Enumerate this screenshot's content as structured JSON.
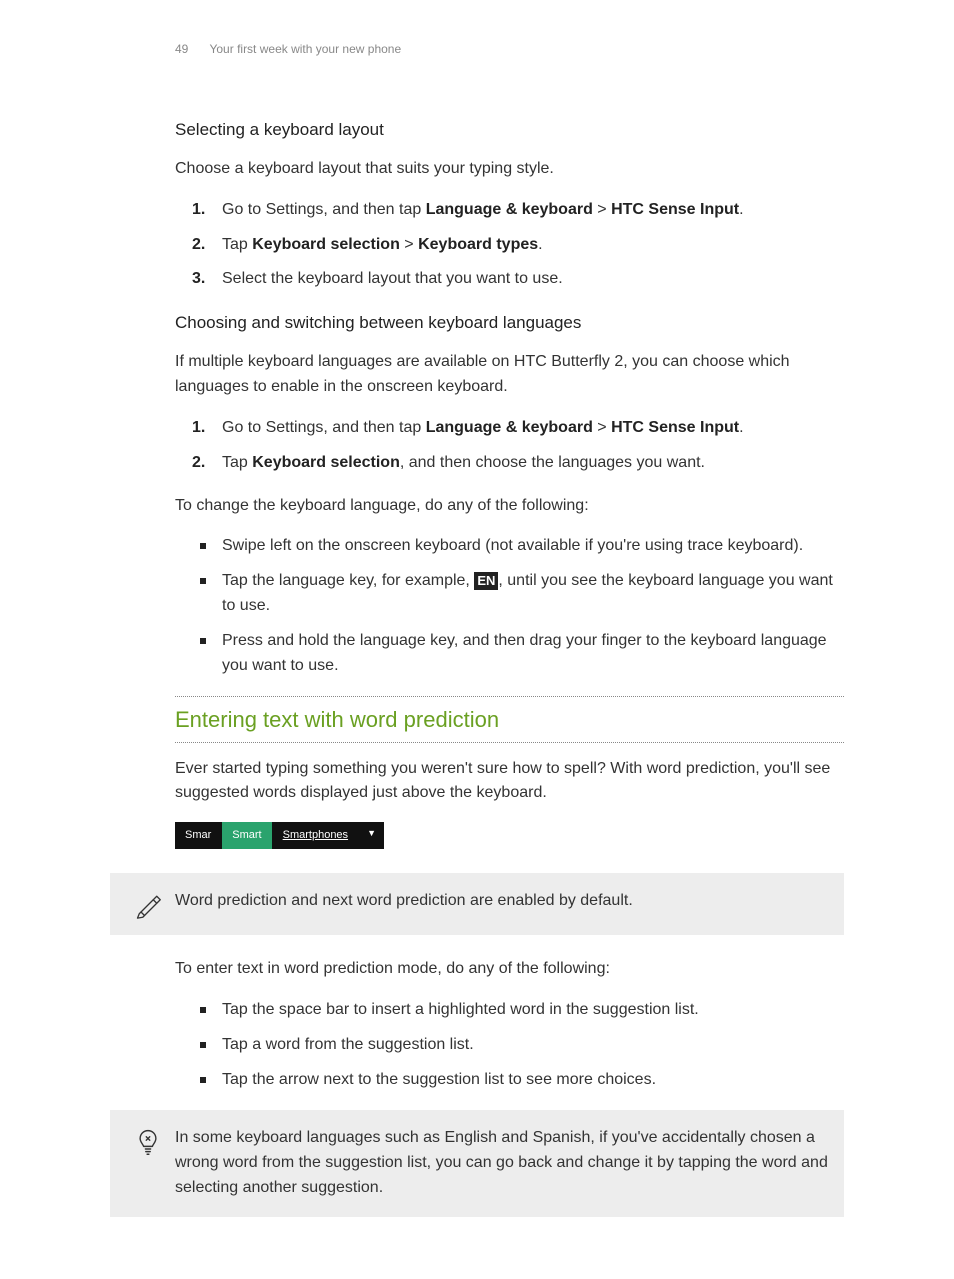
{
  "header": {
    "page_number": "49",
    "chapter": "Your first week with your new phone"
  },
  "section1": {
    "title": "Selecting a keyboard layout",
    "intro": "Choose a keyboard layout that suits your typing style.",
    "steps": {
      "s1_pre": "Go to Settings, and then tap ",
      "s1_b1": "Language & keyboard",
      "s1_mid": " > ",
      "s1_b2": "HTC Sense Input",
      "s1_post": ".",
      "s2_pre": "Tap ",
      "s2_b1": "Keyboard selection",
      "s2_mid": " > ",
      "s2_b2": "Keyboard types",
      "s2_post": ".",
      "s3": "Select the keyboard layout that you want to use."
    }
  },
  "section2": {
    "title": "Choosing and switching between keyboard languages",
    "intro": "If multiple keyboard languages are available on HTC Butterfly 2, you can choose which languages to enable in the onscreen keyboard.",
    "steps": {
      "s1_pre": "Go to Settings, and then tap ",
      "s1_b1": "Language & keyboard",
      "s1_mid": " > ",
      "s1_b2": "HTC Sense Input",
      "s1_post": ".",
      "s2_pre": "Tap ",
      "s2_b1": "Keyboard selection",
      "s2_post": ", and then choose the languages you want."
    },
    "lead": "To change the keyboard language, do any of the following:",
    "bullets": {
      "b1": "Swipe left on the onscreen keyboard (not available if you're using trace keyboard).",
      "b2_pre": "Tap the language key, for example, ",
      "b2_key": "EN",
      "b2_post": ", until you see the keyboard language you want to use.",
      "b3": "Press and hold the language key, and then drag your finger to the keyboard language you want to use."
    }
  },
  "section3": {
    "title": "Entering text with word prediction",
    "intro": "Ever started typing something you weren't sure how to spell? With word prediction, you'll see suggested words displayed just above the keyboard.",
    "pred_bar": {
      "a": "Smar",
      "b": "Smart",
      "c": "Smartphones",
      "arrow": "▼"
    },
    "note1": "Word prediction and next word prediction are enabled by default.",
    "lead": "To enter text in word prediction mode, do any of the following:",
    "bullets": {
      "b1": "Tap the space bar to insert a highlighted word in the suggestion list.",
      "b2": "Tap a word from the suggestion list.",
      "b3": "Tap the arrow next to the suggestion list to see more choices."
    },
    "tip": "In some keyboard languages such as English and Spanish, if you've accidentally chosen a wrong word from the suggestion list, you can go back and change it by tapping the word and selecting another suggestion."
  }
}
